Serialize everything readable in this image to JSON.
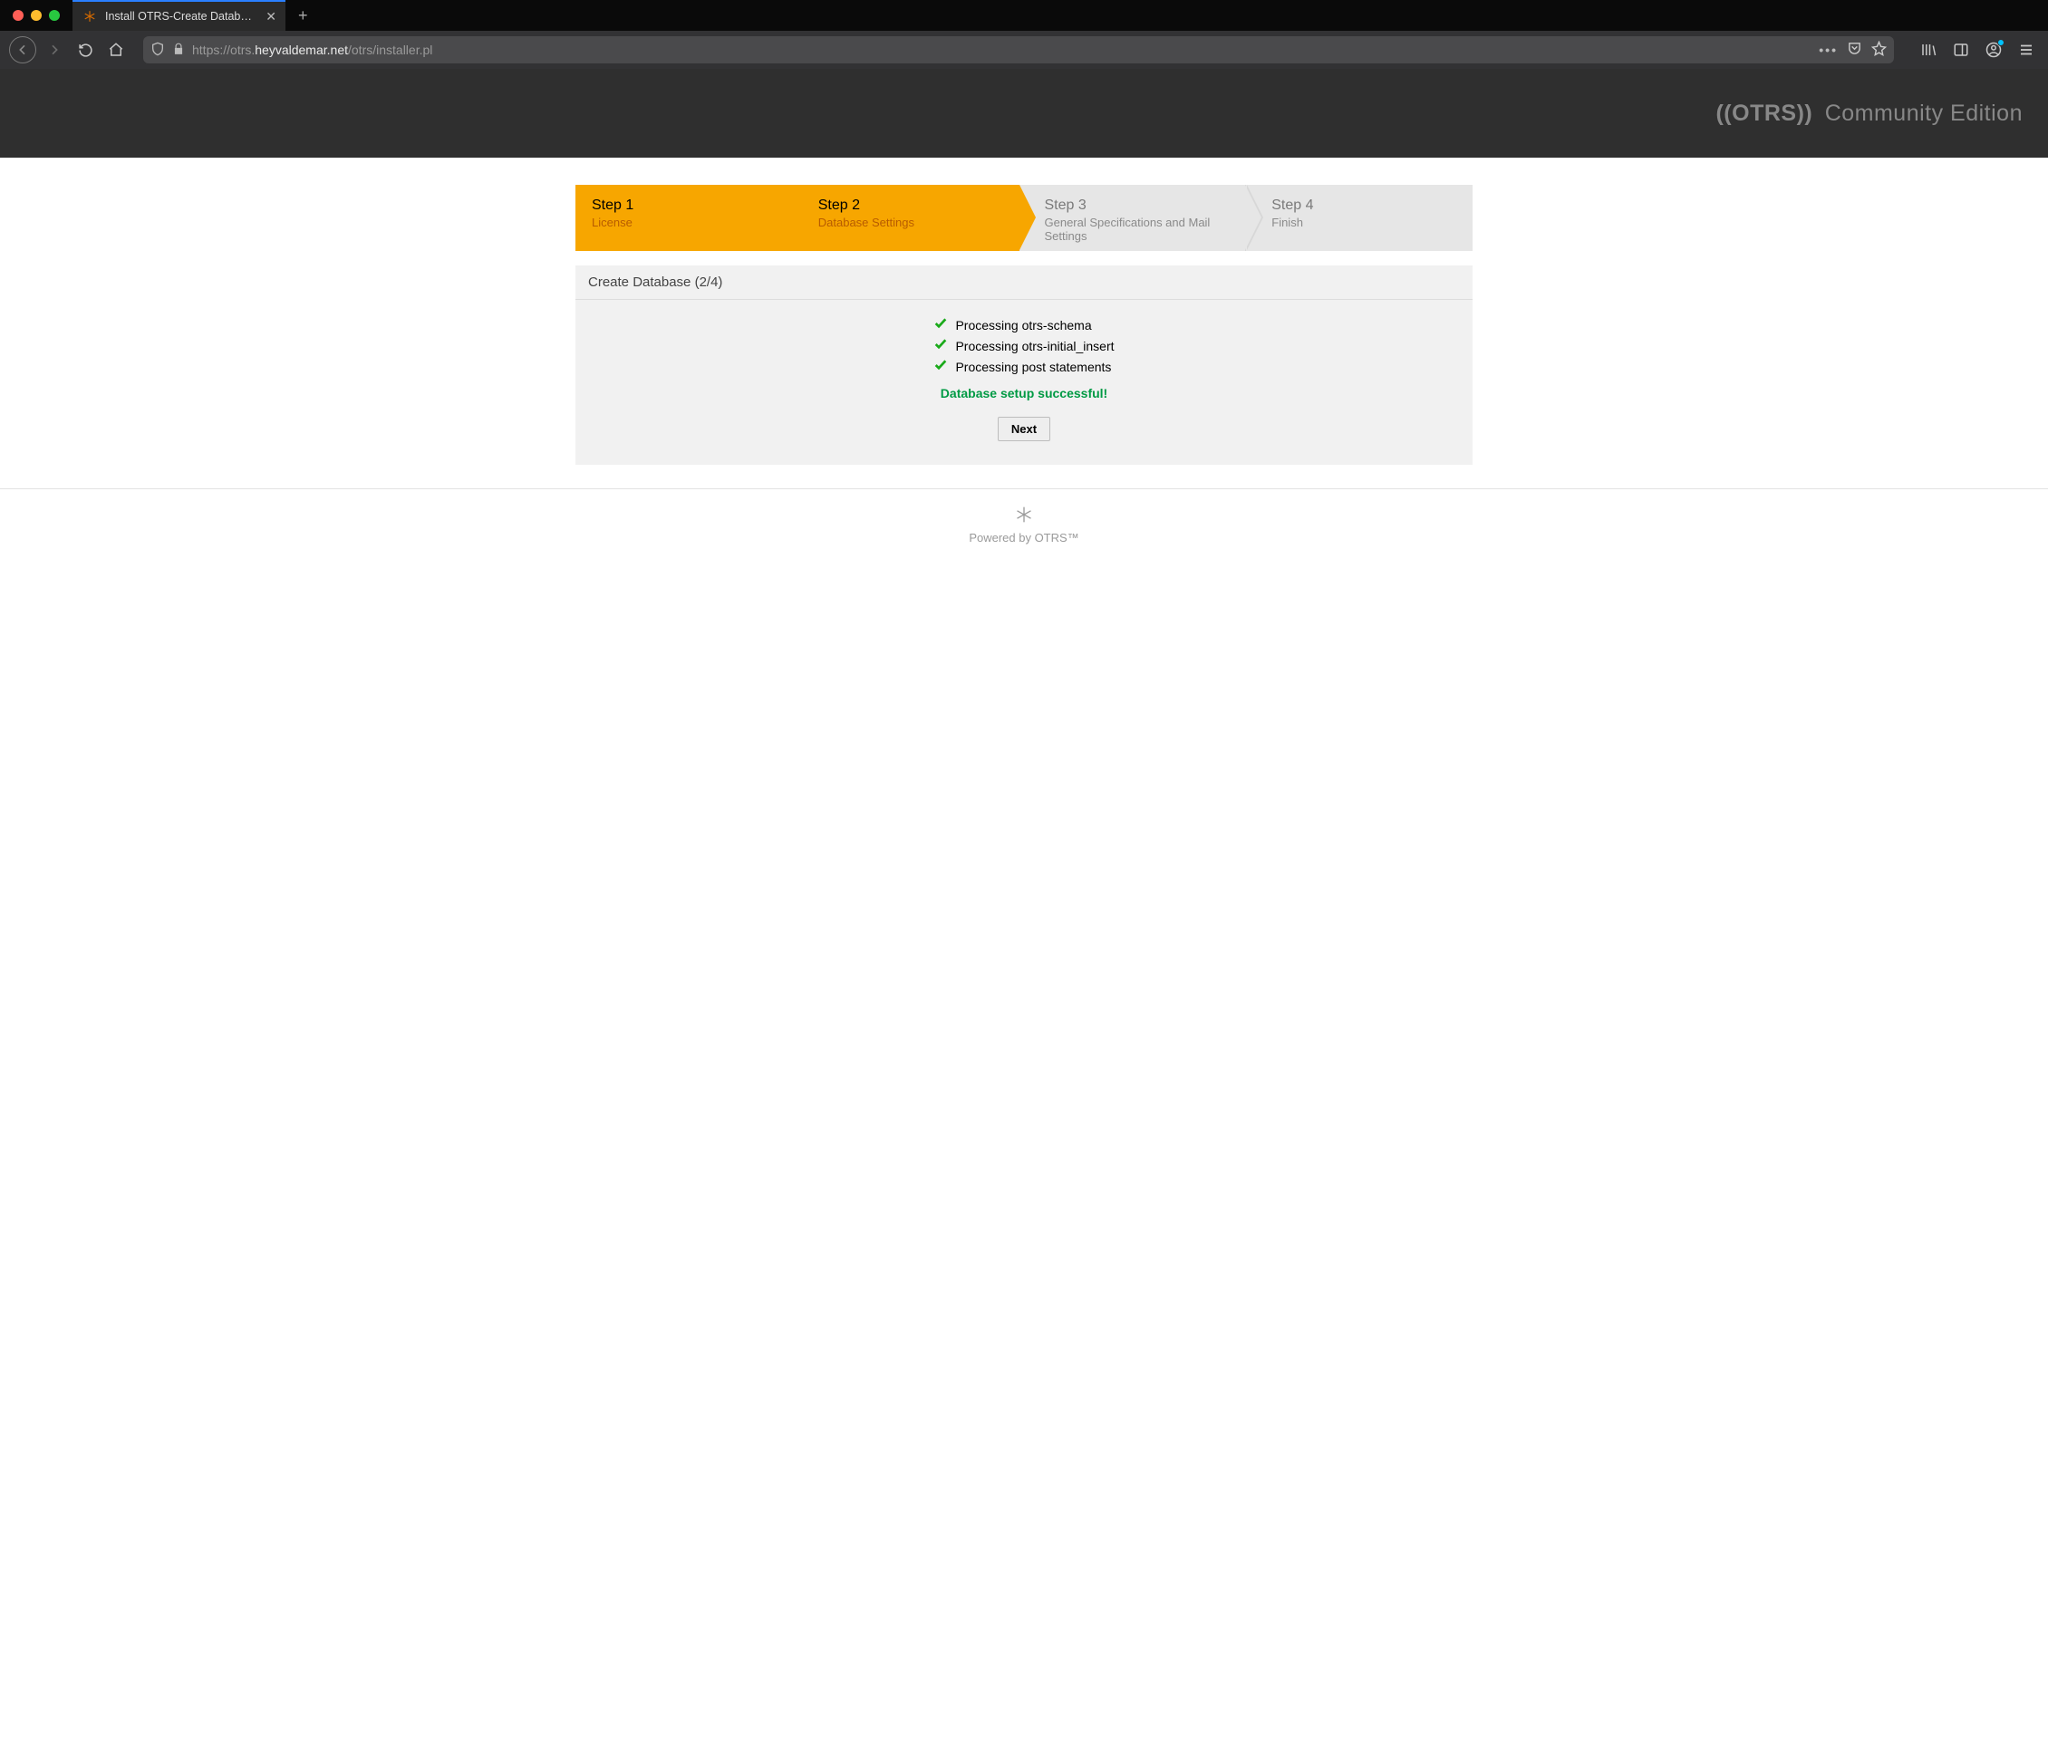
{
  "browser": {
    "tab": {
      "title": "Install OTRS-Create Database -"
    },
    "url": {
      "protocol": "https://",
      "subdomain": "otrs.",
      "domain": "heyvaldemar.net",
      "path": "/otrs/installer.pl"
    }
  },
  "header": {
    "brand": "((OTRS))",
    "edition": "Community Edition"
  },
  "steps": [
    {
      "title": "Step 1",
      "sub": "License",
      "active": true
    },
    {
      "title": "Step 2",
      "sub": "Database Settings",
      "active": true
    },
    {
      "title": "Step 3",
      "sub": "General Specifications and Mail Settings",
      "active": false
    },
    {
      "title": "Step 4",
      "sub": "Finish",
      "active": false
    }
  ],
  "panel": {
    "title": "Create Database (2/4)",
    "items": [
      "Processing otrs-schema",
      "Processing otrs-initial_insert",
      "Processing post statements"
    ],
    "success": "Database setup successful!",
    "next_label": "Next"
  },
  "footer": {
    "text": "Powered by OTRS™"
  }
}
